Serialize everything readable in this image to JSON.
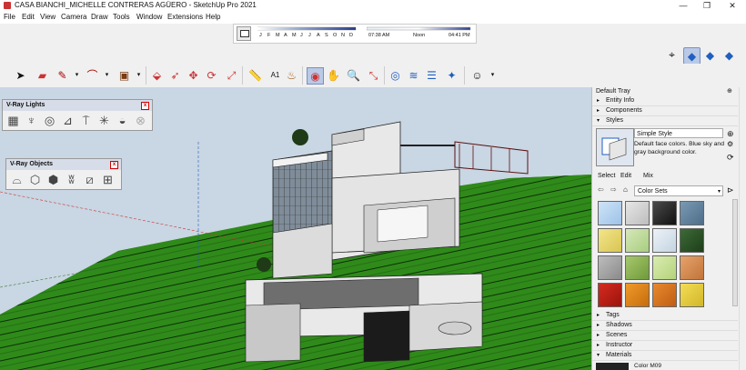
{
  "window": {
    "title": "CASA BIANCHI_MICHELLE CONTRERAS AGÜERO - SketchUp Pro 2021",
    "minimize": "—",
    "maximize": "❐",
    "close": "✕"
  },
  "menu": [
    "File",
    "Edit",
    "View",
    "Camera",
    "Draw",
    "Tools",
    "Window",
    "Extensions",
    "Help"
  ],
  "shadows": {
    "months": [
      "J",
      "F",
      "M",
      "A",
      "M",
      "J",
      "J",
      "A",
      "S",
      "O",
      "N",
      "D"
    ],
    "time_start": "07:38 AM",
    "time_noon": "Noon",
    "time_end": "04:41 PM"
  },
  "vray_lights": {
    "title": "V-Ray Lights",
    "close": "x"
  },
  "vray_objects": {
    "title": "V-Ray Objects",
    "close": "x"
  },
  "tray": {
    "title": "Default Tray",
    "pin": "⊕",
    "sections_top": [
      {
        "label": "Entity Info",
        "arrow": "▸"
      },
      {
        "label": "Components",
        "arrow": "▸"
      },
      {
        "label": "Styles",
        "arrow": "▾"
      }
    ],
    "style_name": "Simple Style",
    "style_desc": "Default face colors. Blue sky and gray background color.",
    "tabs": [
      "Select",
      "Edit",
      "Mix"
    ],
    "color_sets": "Color Sets",
    "sections_bottom": [
      {
        "label": "Tags",
        "arrow": "▸"
      },
      {
        "label": "Shadows",
        "arrow": "▸"
      },
      {
        "label": "Scenes",
        "arrow": "▸"
      },
      {
        "label": "Instructor",
        "arrow": "▸"
      },
      {
        "label": "Materials",
        "arrow": "▾"
      }
    ],
    "material_name": "Color M09"
  },
  "colors": {
    "sky": "#c9d6e3",
    "grass": "#2f8a1a",
    "accent_blue": "#1f5fbf"
  }
}
